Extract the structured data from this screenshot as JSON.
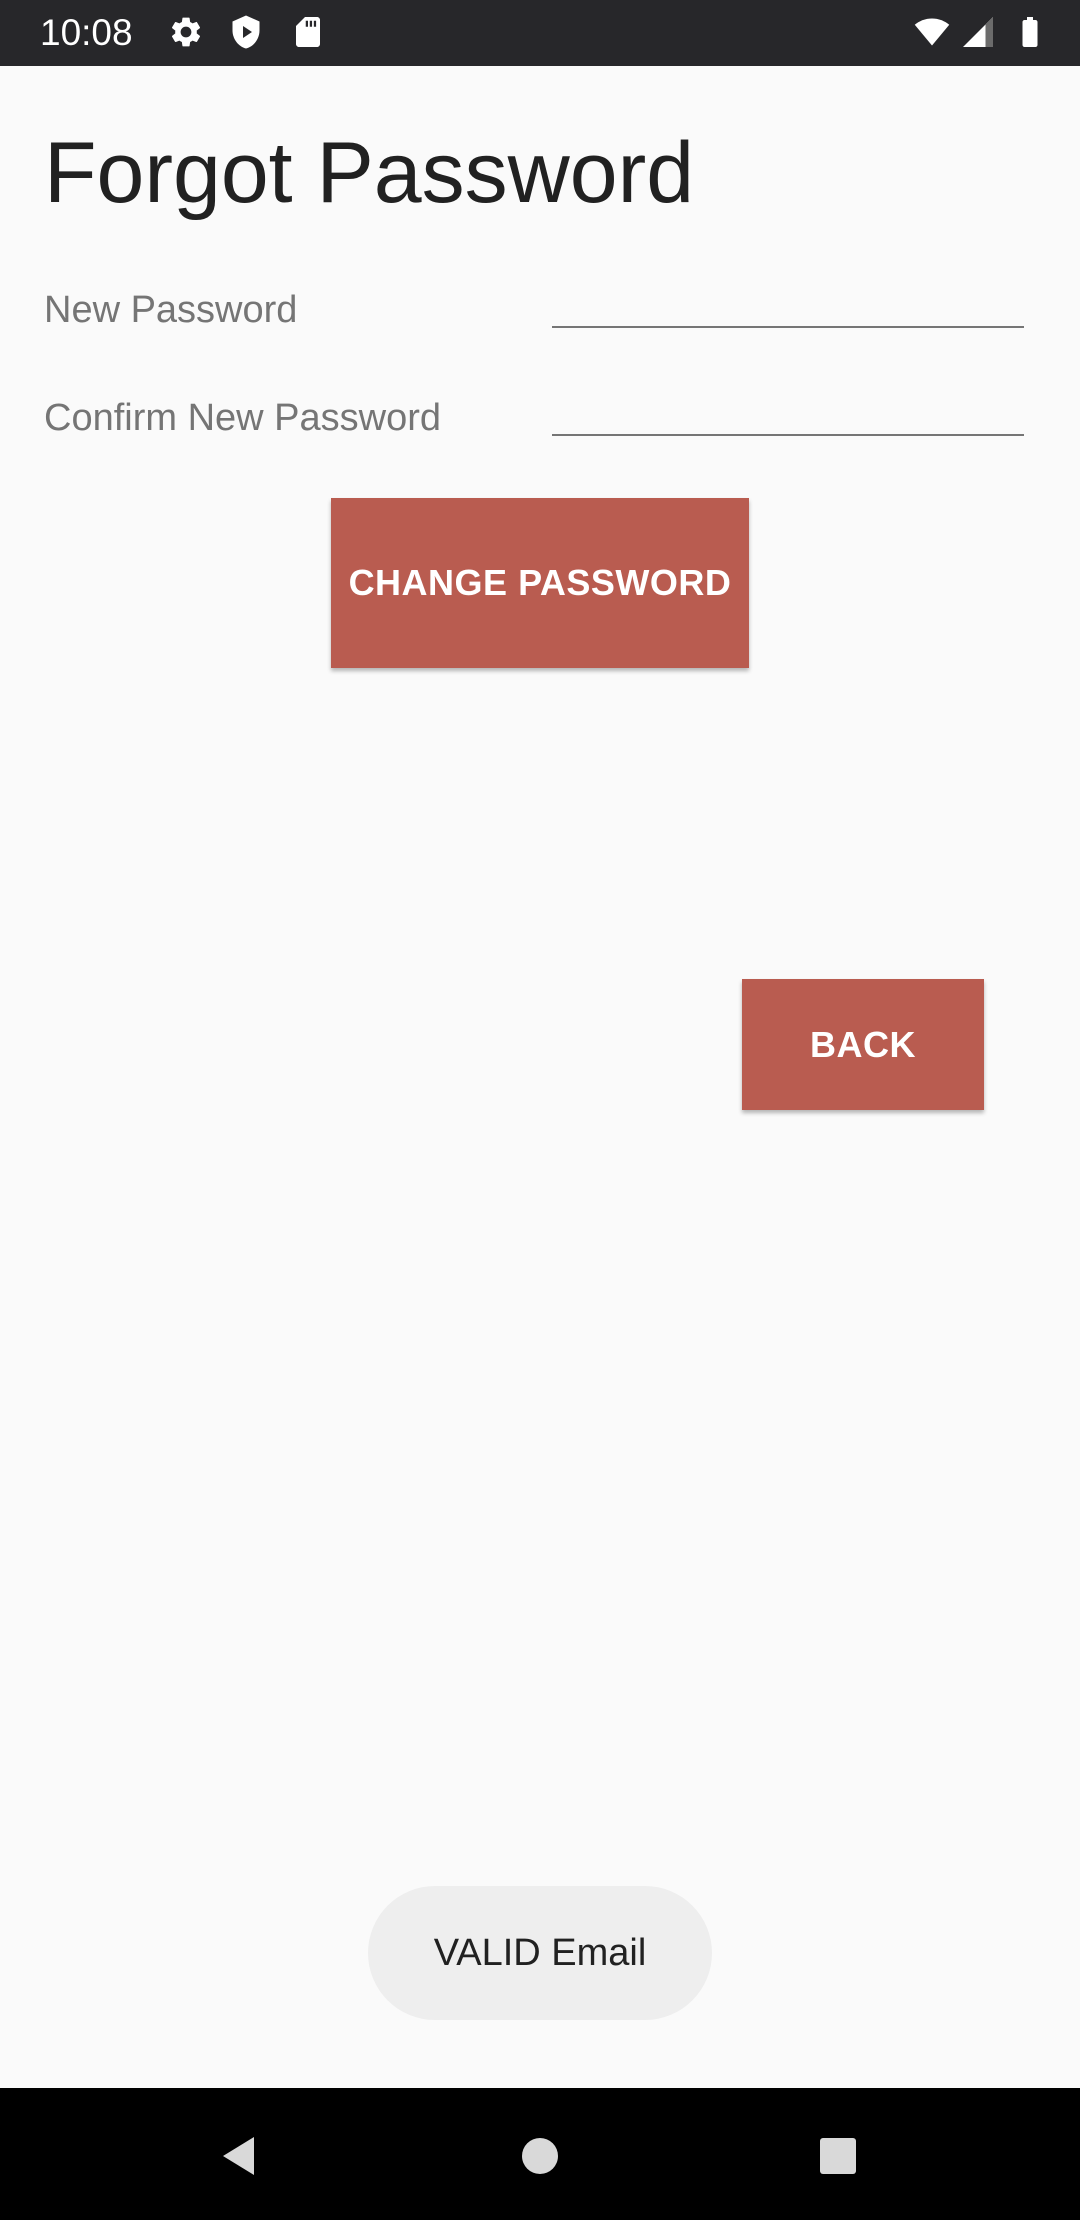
{
  "status_bar": {
    "time": "10:08",
    "icons": [
      "settings-icon",
      "shield-play-icon",
      "sd-card-icon",
      "wifi-icon",
      "signal-icon",
      "battery-icon"
    ]
  },
  "screen": {
    "title": "Forgot Password"
  },
  "form": {
    "new_password_label": "New Password",
    "new_password_value": "",
    "confirm_password_label": "Confirm New Password",
    "confirm_password_value": ""
  },
  "buttons": {
    "change_password": "CHANGE PASSWORD",
    "back": "BACK"
  },
  "toast": {
    "message": "VALID Email"
  },
  "nav_bar": {
    "icons": [
      "back-icon",
      "home-icon",
      "recents-icon"
    ]
  },
  "colors": {
    "accent": "#B95C50",
    "status_bar": "#27272A",
    "background": "#FAFAFA",
    "toast_bg": "#EEEEEE",
    "nav_bar": "#000000"
  }
}
